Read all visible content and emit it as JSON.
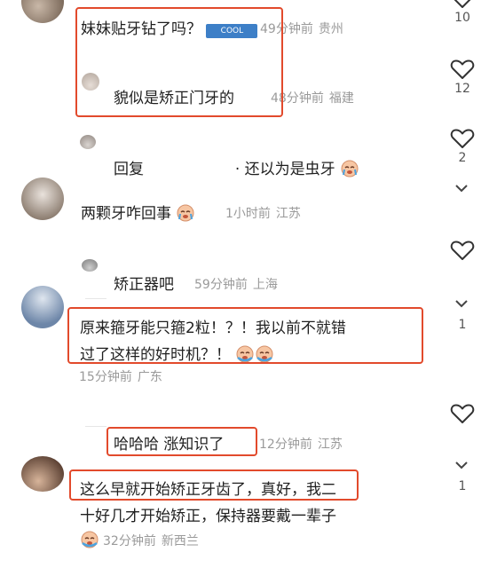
{
  "comments": [
    {
      "text": "妹妹贴牙钻了吗？",
      "sticker": "COOL",
      "time": "49分钟前",
      "location": "贵州"
    },
    {
      "text": "貌似是矫正门牙的",
      "time": "48分钟前",
      "location": "福建"
    },
    {
      "text_a": "回复",
      "text_b": "· 还以为是虫牙"
    },
    {
      "text": "两颗牙咋回事",
      "time": "1小时前",
      "location": "江苏"
    },
    {
      "text": "矫正器吧",
      "time": "59分钟前",
      "location": "上海"
    },
    {
      "line1": "原来箍牙能只箍2粒！？！我以前不就错",
      "line2": "过了这样的好时机？！",
      "time": "15分钟前",
      "location": "广东"
    },
    {
      "text": "哈哈哈 涨知识了",
      "time": "12分钟前",
      "location": "江苏"
    },
    {
      "line1": "这么早就开始矫正牙齿了，真好，我二",
      "line2": "十好几才开始矫正，保持器要戴一辈子",
      "time": "32分钟前",
      "location": "新西兰"
    }
  ],
  "likes": [
    "10",
    "12",
    "2",
    "1",
    "1"
  ],
  "icons": {
    "like": "heart-outline-icon",
    "expand": "chevron-down-icon",
    "emoji": "crying-face-emoji"
  },
  "colors": {
    "highlight": "#e24a2c",
    "meta": "#9a9a9a",
    "text": "#1f1f1f"
  }
}
